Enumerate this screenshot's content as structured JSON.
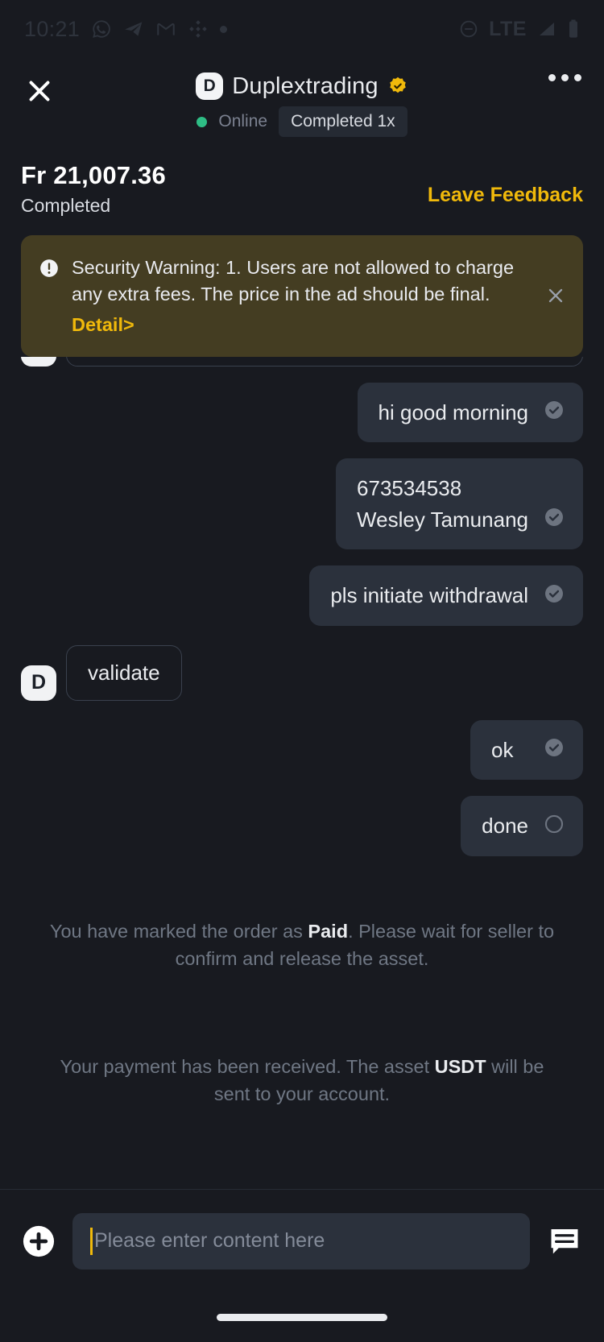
{
  "status_bar": {
    "time": "10:21",
    "left_icons": [
      "whatsapp-icon",
      "telegram-icon",
      "gmail-icon",
      "binance-icon",
      "dot-icon"
    ],
    "network": "LTE",
    "right_icons": [
      "do-not-disturb-icon",
      "signal-icon",
      "battery-icon"
    ]
  },
  "header": {
    "close_label": "close-icon",
    "more_label": "more-options-icon",
    "avatar_initial": "D",
    "merchant_name": "Duplextrading",
    "verified": true,
    "online_label": "Online",
    "completed_badge": "Completed 1x"
  },
  "order": {
    "amount": "Fr 21,007.36",
    "status": "Completed",
    "feedback_label": "Leave Feedback"
  },
  "warning": {
    "text": "Security Warning: 1. Users are not allowed to charge any extra fees. The price in the ad should be final.",
    "detail_label": "Detail>",
    "accent_color": "#f0b90b",
    "background_color": "#443d22"
  },
  "messages": [
    {
      "id": "m0",
      "side": "in",
      "sender_initial": "",
      "text": "",
      "empty": true,
      "status": ""
    },
    {
      "id": "m1",
      "side": "out",
      "text": "hi good morning",
      "status": "delivered"
    },
    {
      "id": "m2",
      "side": "out",
      "text": "673534538\nWesley Tamunang",
      "status": "delivered"
    },
    {
      "id": "m3",
      "side": "out",
      "text": "pls initiate withdrawal",
      "status": "delivered"
    },
    {
      "id": "m4",
      "side": "in",
      "sender_initial": "D",
      "text": "validate",
      "status": ""
    },
    {
      "id": "m5",
      "side": "out",
      "text": "ok",
      "status": "delivered"
    },
    {
      "id": "m6",
      "side": "out",
      "text": "done",
      "status": "pending"
    }
  ],
  "system_messages": [
    {
      "id": "s1",
      "parts": [
        {
          "text": "You have marked the order as ",
          "bold": false
        },
        {
          "text": "Paid",
          "bold": true
        },
        {
          "text": ". Please wait for seller to confirm and release the asset.",
          "bold": false
        }
      ]
    },
    {
      "id": "s2",
      "parts": [
        {
          "text": "Your payment has been received. The asset ",
          "bold": false
        },
        {
          "text": "USDT",
          "bold": true
        },
        {
          "text": " will be sent to your account.",
          "bold": false
        }
      ]
    }
  ],
  "input": {
    "placeholder": "Please enter content here",
    "value": "",
    "add_icon": "plus-circle-icon",
    "quick_reply_icon": "quick-reply-icon",
    "caret_color": "#f0b90b"
  },
  "colors": {
    "background": "#181a20",
    "bubble_out": "#2b313c",
    "accent": "#f0b90b",
    "online": "#2ebd85"
  }
}
